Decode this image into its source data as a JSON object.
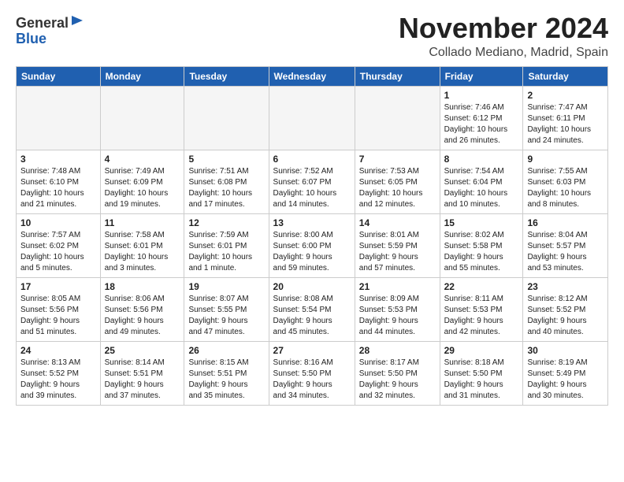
{
  "header": {
    "logo_general": "General",
    "logo_blue": "Blue",
    "month": "November 2024",
    "location": "Collado Mediano, Madrid, Spain"
  },
  "weekdays": [
    "Sunday",
    "Monday",
    "Tuesday",
    "Wednesday",
    "Thursday",
    "Friday",
    "Saturday"
  ],
  "weeks": [
    [
      {
        "day": "",
        "info": ""
      },
      {
        "day": "",
        "info": ""
      },
      {
        "day": "",
        "info": ""
      },
      {
        "day": "",
        "info": ""
      },
      {
        "day": "",
        "info": ""
      },
      {
        "day": "1",
        "info": "Sunrise: 7:46 AM\nSunset: 6:12 PM\nDaylight: 10 hours\nand 26 minutes."
      },
      {
        "day": "2",
        "info": "Sunrise: 7:47 AM\nSunset: 6:11 PM\nDaylight: 10 hours\nand 24 minutes."
      }
    ],
    [
      {
        "day": "3",
        "info": "Sunrise: 7:48 AM\nSunset: 6:10 PM\nDaylight: 10 hours\nand 21 minutes."
      },
      {
        "day": "4",
        "info": "Sunrise: 7:49 AM\nSunset: 6:09 PM\nDaylight: 10 hours\nand 19 minutes."
      },
      {
        "day": "5",
        "info": "Sunrise: 7:51 AM\nSunset: 6:08 PM\nDaylight: 10 hours\nand 17 minutes."
      },
      {
        "day": "6",
        "info": "Sunrise: 7:52 AM\nSunset: 6:07 PM\nDaylight: 10 hours\nand 14 minutes."
      },
      {
        "day": "7",
        "info": "Sunrise: 7:53 AM\nSunset: 6:05 PM\nDaylight: 10 hours\nand 12 minutes."
      },
      {
        "day": "8",
        "info": "Sunrise: 7:54 AM\nSunset: 6:04 PM\nDaylight: 10 hours\nand 10 minutes."
      },
      {
        "day": "9",
        "info": "Sunrise: 7:55 AM\nSunset: 6:03 PM\nDaylight: 10 hours\nand 8 minutes."
      }
    ],
    [
      {
        "day": "10",
        "info": "Sunrise: 7:57 AM\nSunset: 6:02 PM\nDaylight: 10 hours\nand 5 minutes."
      },
      {
        "day": "11",
        "info": "Sunrise: 7:58 AM\nSunset: 6:01 PM\nDaylight: 10 hours\nand 3 minutes."
      },
      {
        "day": "12",
        "info": "Sunrise: 7:59 AM\nSunset: 6:01 PM\nDaylight: 10 hours\nand 1 minute."
      },
      {
        "day": "13",
        "info": "Sunrise: 8:00 AM\nSunset: 6:00 PM\nDaylight: 9 hours\nand 59 minutes."
      },
      {
        "day": "14",
        "info": "Sunrise: 8:01 AM\nSunset: 5:59 PM\nDaylight: 9 hours\nand 57 minutes."
      },
      {
        "day": "15",
        "info": "Sunrise: 8:02 AM\nSunset: 5:58 PM\nDaylight: 9 hours\nand 55 minutes."
      },
      {
        "day": "16",
        "info": "Sunrise: 8:04 AM\nSunset: 5:57 PM\nDaylight: 9 hours\nand 53 minutes."
      }
    ],
    [
      {
        "day": "17",
        "info": "Sunrise: 8:05 AM\nSunset: 5:56 PM\nDaylight: 9 hours\nand 51 minutes."
      },
      {
        "day": "18",
        "info": "Sunrise: 8:06 AM\nSunset: 5:56 PM\nDaylight: 9 hours\nand 49 minutes."
      },
      {
        "day": "19",
        "info": "Sunrise: 8:07 AM\nSunset: 5:55 PM\nDaylight: 9 hours\nand 47 minutes."
      },
      {
        "day": "20",
        "info": "Sunrise: 8:08 AM\nSunset: 5:54 PM\nDaylight: 9 hours\nand 45 minutes."
      },
      {
        "day": "21",
        "info": "Sunrise: 8:09 AM\nSunset: 5:53 PM\nDaylight: 9 hours\nand 44 minutes."
      },
      {
        "day": "22",
        "info": "Sunrise: 8:11 AM\nSunset: 5:53 PM\nDaylight: 9 hours\nand 42 minutes."
      },
      {
        "day": "23",
        "info": "Sunrise: 8:12 AM\nSunset: 5:52 PM\nDaylight: 9 hours\nand 40 minutes."
      }
    ],
    [
      {
        "day": "24",
        "info": "Sunrise: 8:13 AM\nSunset: 5:52 PM\nDaylight: 9 hours\nand 39 minutes."
      },
      {
        "day": "25",
        "info": "Sunrise: 8:14 AM\nSunset: 5:51 PM\nDaylight: 9 hours\nand 37 minutes."
      },
      {
        "day": "26",
        "info": "Sunrise: 8:15 AM\nSunset: 5:51 PM\nDaylight: 9 hours\nand 35 minutes."
      },
      {
        "day": "27",
        "info": "Sunrise: 8:16 AM\nSunset: 5:50 PM\nDaylight: 9 hours\nand 34 minutes."
      },
      {
        "day": "28",
        "info": "Sunrise: 8:17 AM\nSunset: 5:50 PM\nDaylight: 9 hours\nand 32 minutes."
      },
      {
        "day": "29",
        "info": "Sunrise: 8:18 AM\nSunset: 5:50 PM\nDaylight: 9 hours\nand 31 minutes."
      },
      {
        "day": "30",
        "info": "Sunrise: 8:19 AM\nSunset: 5:49 PM\nDaylight: 9 hours\nand 30 minutes."
      }
    ]
  ]
}
